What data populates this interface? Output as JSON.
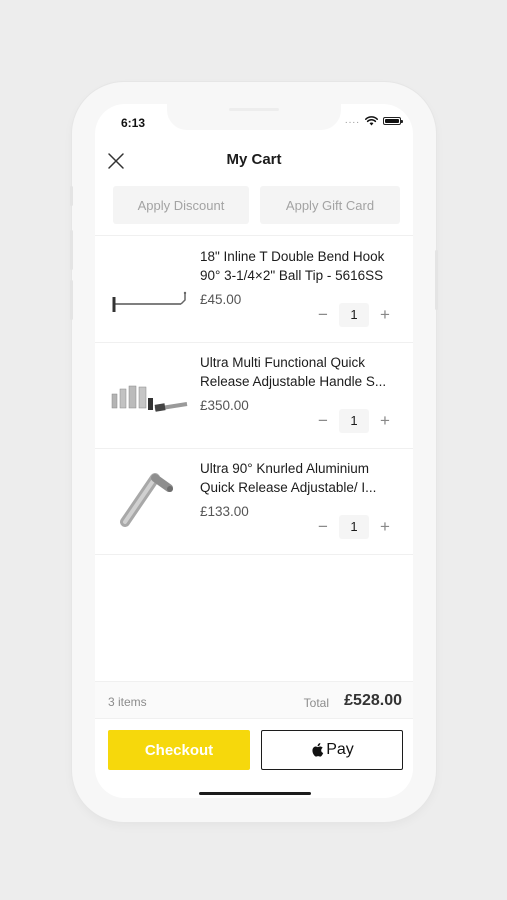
{
  "status_bar": {
    "time": "6:13",
    "signal": "....",
    "icons": [
      "wifi-icon",
      "battery-icon"
    ]
  },
  "header": {
    "title": "My Cart",
    "close_icon": "close-icon"
  },
  "actions": {
    "apply_discount": "Apply Discount",
    "apply_gift_card": "Apply Gift Card"
  },
  "cart": {
    "items": [
      {
        "name": "18\" Inline T Double Bend Hook 90° 3-1/4×2\" Ball Tip - 5616SS",
        "price": "£45.00",
        "quantity": "1",
        "image": "t-hook-tool"
      },
      {
        "name": "Ultra Multi Functional Quick Release Adjustable Handle S...",
        "price": "£350.00",
        "quantity": "1",
        "image": "handle-set"
      },
      {
        "name": "Ultra 90° Knurled Aluminium Quick Release Adjustable/ I...",
        "price": "£133.00",
        "quantity": "1",
        "image": "knurled-handle"
      }
    ],
    "minus_symbol": "−",
    "plus_symbol": "+"
  },
  "summary": {
    "items_count": "3 items",
    "total_label": "Total",
    "total_value": "£528.00"
  },
  "buttons": {
    "checkout": "Checkout",
    "apple_pay": "Pay"
  },
  "colors": {
    "checkout_bg": "#f6d80c",
    "background": "#ededed",
    "text": "#1c1c1c"
  }
}
